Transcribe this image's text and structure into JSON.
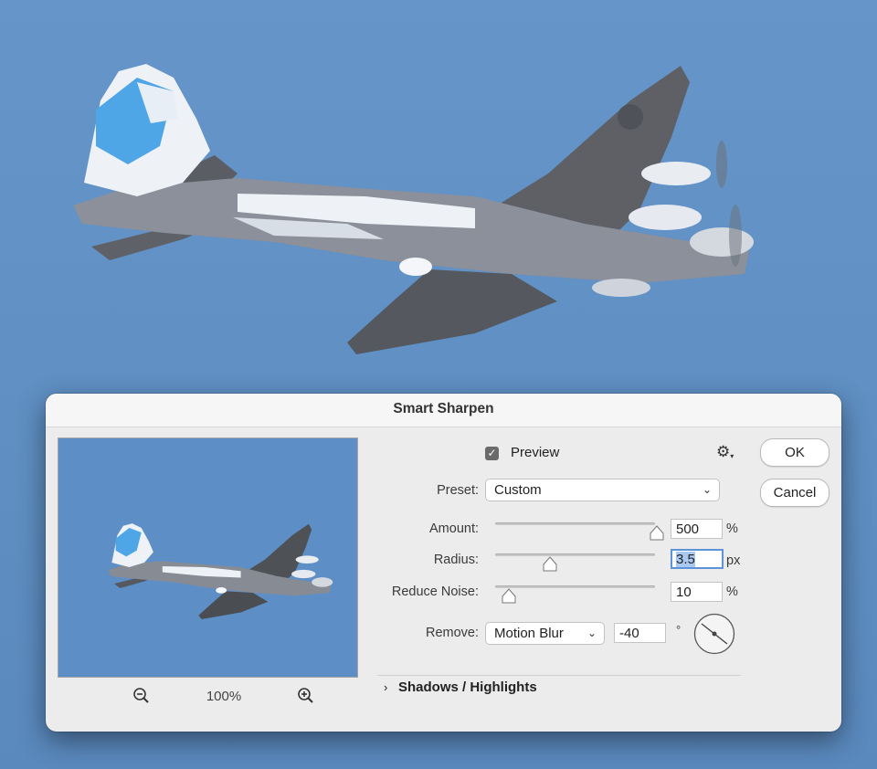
{
  "dialog": {
    "title": "Smart Sharpen",
    "preview_checkbox": {
      "label": "Preview",
      "checked": true
    },
    "settings_icon": "gear-icon",
    "preset": {
      "label": "Preset:",
      "value": "Custom"
    },
    "amount": {
      "label": "Amount:",
      "value": "500",
      "unit": "%",
      "slider_fraction": 0.98
    },
    "radius": {
      "label": "Radius:",
      "value": "3.5",
      "unit": "px",
      "slider_fraction": 0.34
    },
    "reduce_noise": {
      "label": "Reduce Noise:",
      "value": "10",
      "unit": "%",
      "slider_fraction": 0.08
    },
    "remove": {
      "label": "Remove:",
      "value": "Motion Blur",
      "angle": "-40",
      "angle_unit": "°"
    },
    "shadows_highlights": {
      "label": "Shadows / Highlights",
      "expanded": false
    },
    "zoom": {
      "level": "100%",
      "zoom_out_icon": "zoom-out-icon",
      "zoom_in_icon": "zoom-in-icon"
    },
    "ok_label": "OK",
    "cancel_label": "Cancel"
  },
  "colors": {
    "sky": "#6595c9",
    "dialog_bg": "#ececec",
    "focus_ring": "#5c93d9"
  }
}
